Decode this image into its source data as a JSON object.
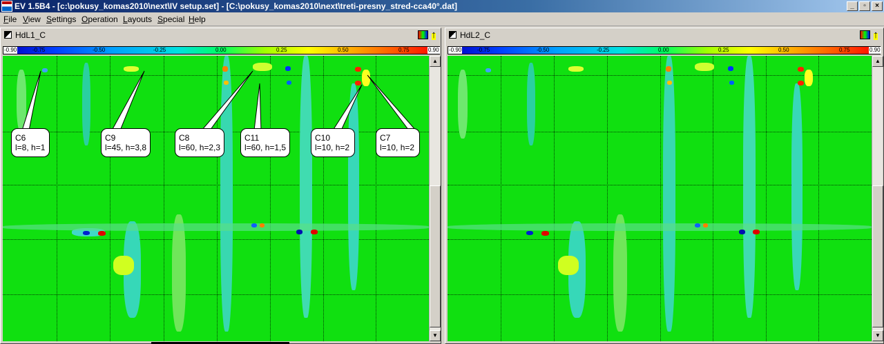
{
  "window": {
    "title": "EV 1.5B4 - [c:\\pokusy_komas2010\\next\\IV setup.set] - [C:\\pokusy_komas2010\\next\\treti-presny_stred-cca40°.dat]",
    "minimize": "_",
    "restore": "▫",
    "close": "×"
  },
  "menu": [
    "File",
    "View",
    "Settings",
    "Operation",
    "Layouts",
    "Special",
    "Help"
  ],
  "panels": [
    {
      "title": "HdL1_C",
      "colorbar_ticks": [
        "-0.90",
        "-0.75",
        "-0.50",
        "-0.25",
        "0.00",
        "0.25",
        "0.50",
        "0.75",
        "0.90"
      ],
      "callouts": [
        {
          "name": "C6",
          "params": "l=8, h=1"
        },
        {
          "name": "C9",
          "params": "l=45, h=3,8"
        },
        {
          "name": "C8",
          "params": "l=60, h=2,3"
        },
        {
          "name": "C11",
          "params": "l=60, h=1,5"
        },
        {
          "name": "C10",
          "params": "l=10, h=2"
        },
        {
          "name": "C7",
          "params": "l=10, h=2"
        }
      ]
    },
    {
      "title": "HdL2_C",
      "colorbar_ticks": [
        "-0.90",
        "-0.75",
        "-0.50",
        "-0.25",
        "0.00",
        "0.25",
        "0.50",
        "0.75",
        "0.90"
      ]
    }
  ],
  "colors": {
    "plot_background": "#10e010",
    "titlebar": "#0a246a"
  }
}
